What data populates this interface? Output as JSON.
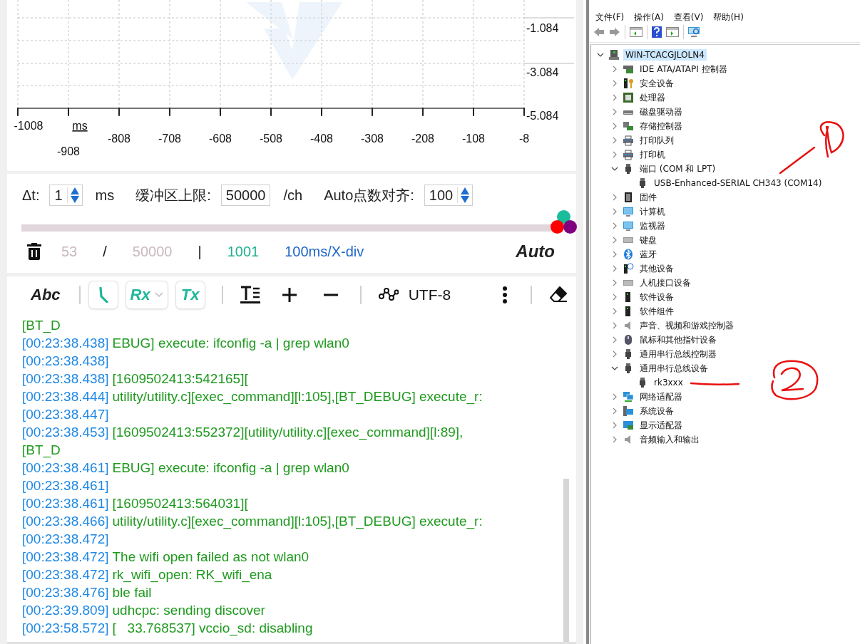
{
  "plot": {
    "x_ticks": [
      "-1008",
      "-908",
      "-808",
      "-708",
      "-608",
      "-508",
      "-408",
      "-308",
      "-208",
      "-108",
      "-8"
    ],
    "x_unit": "ms",
    "y_ticks": [
      "-1.084",
      "-3.084",
      "-5.084"
    ]
  },
  "settings": [
    {
      "kind": "spin",
      "label": "Δt:",
      "value": "1",
      "unit": "ms"
    },
    {
      "kind": "field",
      "label": "缓冲区上限:",
      "value": "50000",
      "unit": "/ch"
    },
    {
      "kind": "spin",
      "label": "Auto点数对齐:",
      "value": "100"
    }
  ],
  "slider": {
    "level": 1
  },
  "channels": [
    {
      "color": "#1abc9c"
    },
    {
      "color": "#ff0000"
    },
    {
      "color": "#800080"
    }
  ],
  "status": {
    "count": "53",
    "slash": "/",
    "limit": "50000",
    "bar": "|",
    "points": "1001",
    "scale": "100ms/X-div",
    "mode": "Auto"
  },
  "toolbar": [
    {
      "kind": "label",
      "text": "Abc"
    },
    {
      "kind": "sep"
    },
    {
      "kind": "timestamp",
      "on": true
    },
    {
      "kind": "rx",
      "text": "Rx",
      "on": true
    },
    {
      "kind": "tx",
      "text": "Tx",
      "on": true
    },
    {
      "kind": "sep"
    },
    {
      "kind": "format"
    },
    {
      "kind": "plus"
    },
    {
      "kind": "minus"
    },
    {
      "kind": "sep"
    },
    {
      "kind": "encoding",
      "text": "UTF-8"
    },
    {
      "kind": "more"
    },
    {
      "kind": "sep"
    },
    {
      "kind": "clear"
    }
  ],
  "log": [
    {
      "text": "[BT_D"
    },
    {
      "time": "[00:23:38.438]",
      "text": "EBUG] execute: ifconfig -a | grep wlan0"
    },
    {
      "time": "[00:23:38.438]"
    },
    {
      "time": "[00:23:38.438]",
      "text": "[1609502413:542165]["
    },
    {
      "time": "[00:23:38.444]",
      "text": "utility/utility.c][exec_command][l:105],[BT_DEBUG] execute_r:"
    },
    {
      "time": "[00:23:38.447]"
    },
    {
      "time": "[00:23:38.453]",
      "text": "[1609502413:552372][utility/utility.c][exec_command][l:89],"
    },
    {
      "text": "[BT_D"
    },
    {
      "time": "[00:23:38.461]",
      "text": "EBUG] execute: ifconfig -a | grep wlan0"
    },
    {
      "time": "[00:23:38.461]"
    },
    {
      "time": "[00:23:38.461]",
      "text": "[1609502413:564031]["
    },
    {
      "time": "[00:23:38.466]",
      "text": "utility/utility.c][exec_command][l:105],[BT_DEBUG] execute_r:"
    },
    {
      "time": "[00:23:38.472]"
    },
    {
      "time": "[00:23:38.472]",
      "text": "The wifi open failed as not wlan0"
    },
    {
      "time": "[00:23:38.472]",
      "text": "rk_wifi_open: RK_wifi_ena"
    },
    {
      "time": "[00:23:38.476]",
      "text": "ble fail"
    },
    {
      "time": "[00:23:39.809]",
      "text": "udhcpc: sending discover"
    },
    {
      "time": "[00:23:58.572]",
      "text": "[   33.768537] vccio_sd: disabling"
    }
  ],
  "device_manager": {
    "menu": [
      "文件(F)",
      "操作(A)",
      "查看(V)",
      "帮助(H)"
    ],
    "tree": {
      "label": "WIN-TCACGJLOLN4",
      "expanded": true,
      "selected": true,
      "children": [
        {
          "label": "IDE ATA/ATAPI 控制器",
          "expanded": false,
          "selected": false
        },
        {
          "label": "安全设备",
          "expanded": false,
          "selected": false
        },
        {
          "label": "处理器",
          "expanded": false,
          "selected": false
        },
        {
          "label": "磁盘驱动器",
          "expanded": false,
          "selected": false
        },
        {
          "label": "存储控制器",
          "expanded": false,
          "selected": false
        },
        {
          "label": "打印队列",
          "expanded": false,
          "selected": false
        },
        {
          "label": "打印机",
          "expanded": false,
          "selected": false
        },
        {
          "label": "端口 (COM 和 LPT)",
          "expanded": true,
          "selected": false,
          "children": [
            {
              "label": "USB-Enhanced-SERIAL CH343 (COM14)",
              "selected": false
            }
          ]
        },
        {
          "label": "固件",
          "expanded": false,
          "selected": false
        },
        {
          "label": "计算机",
          "expanded": false,
          "selected": false
        },
        {
          "label": "监视器",
          "expanded": false,
          "selected": false
        },
        {
          "label": "键盘",
          "expanded": false,
          "selected": false
        },
        {
          "label": "蓝牙",
          "expanded": false,
          "selected": false
        },
        {
          "label": "其他设备",
          "expanded": false,
          "selected": false
        },
        {
          "label": "人机接口设备",
          "expanded": false,
          "selected": false
        },
        {
          "label": "软件设备",
          "expanded": false,
          "selected": false
        },
        {
          "label": "软件组件",
          "expanded": false,
          "selected": false
        },
        {
          "label": "声音、视频和游戏控制器",
          "expanded": false,
          "selected": false
        },
        {
          "label": "鼠标和其他指针设备",
          "expanded": false,
          "selected": false
        },
        {
          "label": "通用串行总线控制器",
          "expanded": false,
          "selected": false
        },
        {
          "label": "通用串行总线设备",
          "expanded": true,
          "selected": false,
          "children": [
            {
              "label": "rk3xxx",
              "selected": false
            }
          ]
        },
        {
          "label": "网络适配器",
          "expanded": false,
          "selected": false
        },
        {
          "label": "系统设备",
          "expanded": false,
          "selected": false
        },
        {
          "label": "显示适配器",
          "expanded": false,
          "selected": false
        },
        {
          "label": "音频输入和输出",
          "expanded": false,
          "selected": false
        }
      ]
    }
  }
}
